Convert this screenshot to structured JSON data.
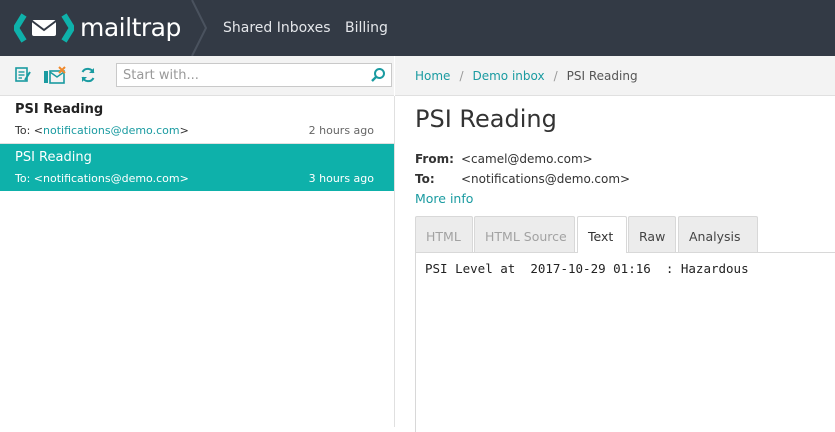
{
  "app": {
    "logo_text": "mailtrap",
    "brand_color": "#0eb1aa",
    "topbar_color": "#333a45"
  },
  "nav": {
    "shared_inboxes": "Shared Inboxes",
    "billing": "Billing"
  },
  "toolbar": {
    "icons": [
      "mark-read-icon",
      "clear-inbox-icon",
      "refresh-icon"
    ],
    "search_placeholder": "Start with...",
    "search_value": ""
  },
  "breadcrumb": {
    "home": "Home",
    "inbox": "Demo inbox",
    "current": "PSI Reading"
  },
  "messages": [
    {
      "subject": "PSI Reading",
      "to_prefix": "To: <",
      "to_addr": "notifications@demo.com",
      "to_suffix": ">",
      "time": "2 hours ago",
      "selected": false
    },
    {
      "subject": "PSI Reading",
      "to_prefix": "To: <",
      "to_addr": "notifications@demo.com",
      "to_suffix": ">",
      "time": "3 hours ago",
      "selected": true
    }
  ],
  "detail": {
    "title": "PSI Reading",
    "from_label": "From:",
    "from_value": "<camel@demo.com>",
    "to_label": "To:",
    "to_value": "<notifications@demo.com>",
    "more_info": "More info",
    "tabs": [
      "HTML",
      "HTML Source",
      "Text",
      "Raw",
      "Analysis"
    ],
    "active_tab": "Text",
    "body_text": "PSI Level at  2017-10-29 01:16  : Hazardous"
  }
}
